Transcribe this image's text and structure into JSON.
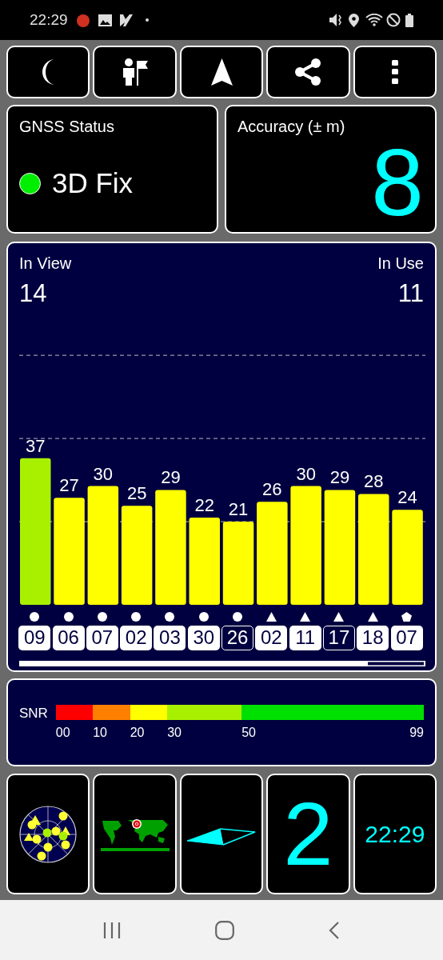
{
  "status_bar": {
    "time": "22:29"
  },
  "gnss_status": {
    "title": "GNSS Status",
    "fixed": true,
    "fix": "3D Fix"
  },
  "accuracy": {
    "title": "Accuracy (± m)",
    "value": "8"
  },
  "satellites": {
    "in_view_label": "In View",
    "in_view": "14",
    "in_use_label": "In Use",
    "in_use": "11",
    "chart_data": {
      "type": "bar",
      "categories": [
        "09",
        "06",
        "07",
        "02",
        "03",
        "30",
        "26",
        "02",
        "11",
        "17",
        "18",
        "07"
      ],
      "values": [
        37,
        27,
        30,
        25,
        29,
        22,
        21,
        26,
        30,
        29,
        28,
        24
      ],
      "data_labels": true
    },
    "markers": [
      {
        "kind": "circle",
        "used": true
      },
      {
        "kind": "circle",
        "used": true
      },
      {
        "kind": "circle",
        "used": true
      },
      {
        "kind": "circle",
        "used": true
      },
      {
        "kind": "circle",
        "used": true
      },
      {
        "kind": "circle",
        "used": true
      },
      {
        "kind": "circle",
        "used": false
      },
      {
        "kind": "triangle",
        "used": true
      },
      {
        "kind": "triangle",
        "used": true
      },
      {
        "kind": "triangle",
        "used": false
      },
      {
        "kind": "triangle",
        "used": true
      },
      {
        "kind": "pentagon",
        "used": true
      }
    ]
  },
  "snr_legend": {
    "label": "SNR",
    "stops": [
      "00",
      "10",
      "20",
      "30",
      "50",
      "99"
    ],
    "segments": [
      {
        "color": "#ff0000"
      },
      {
        "color": "#ff8000"
      },
      {
        "color": "#ffff00"
      },
      {
        "color": "#a8f000"
      },
      {
        "color": "#00e000"
      }
    ]
  },
  "tiles": {
    "counter": "2",
    "clock": "22:29"
  }
}
